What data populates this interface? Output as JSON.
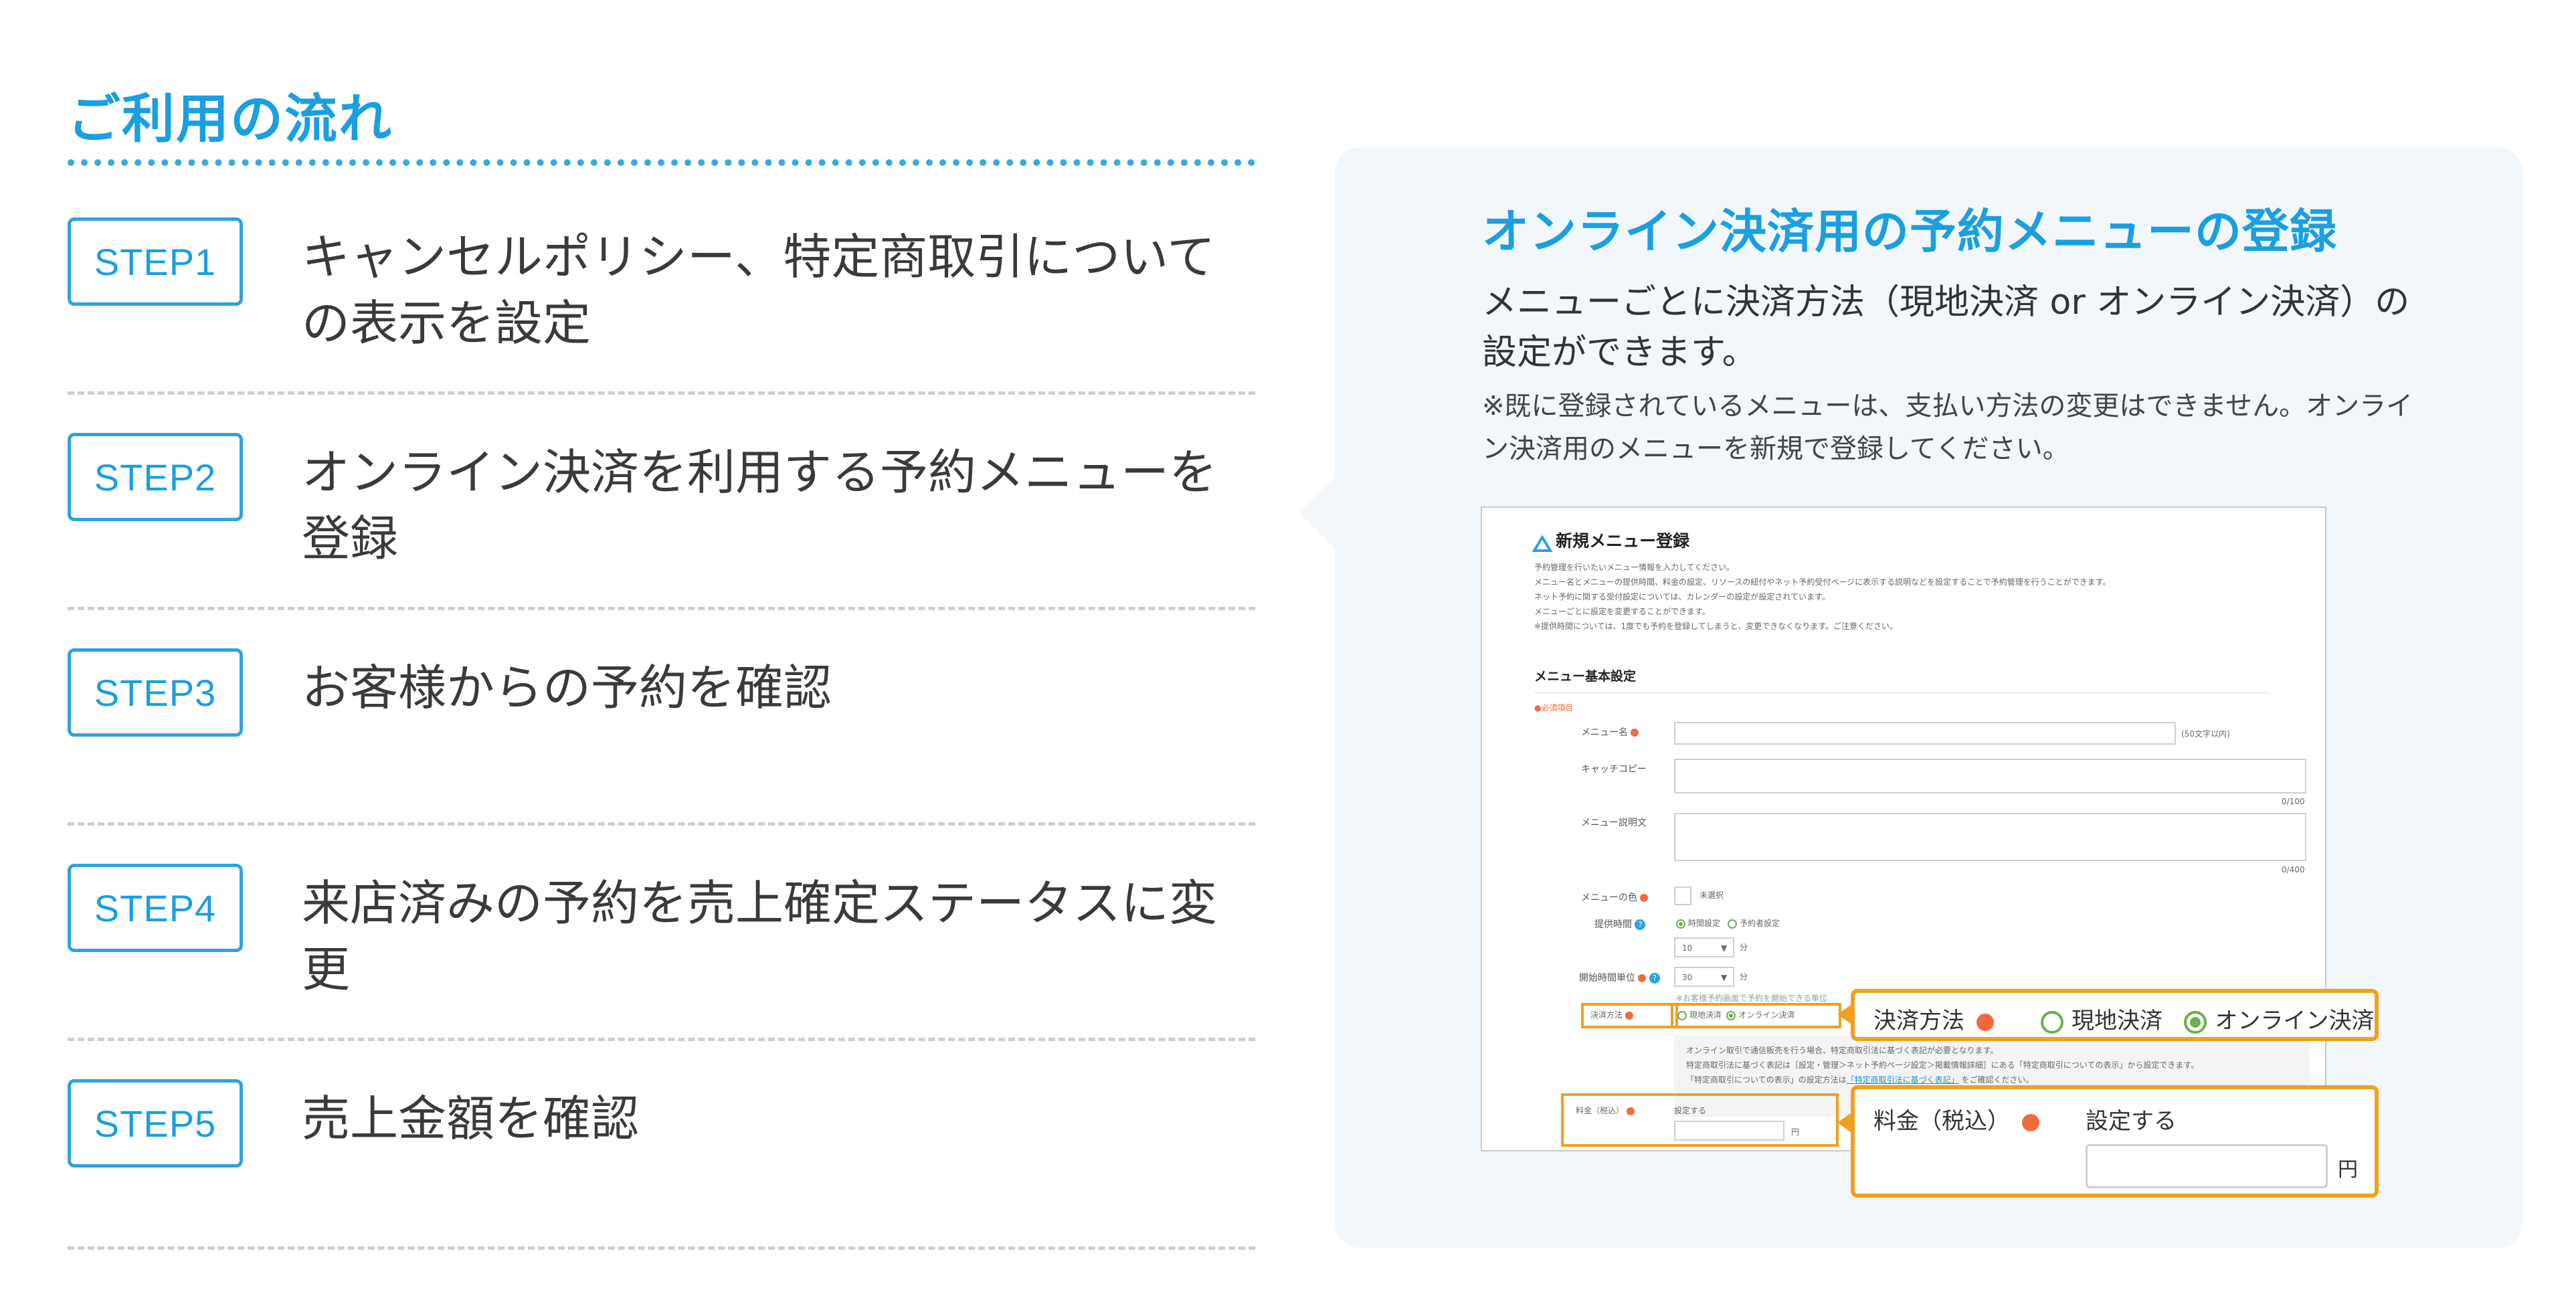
{
  "section_title": "ご利用の流れ",
  "steps": [
    {
      "badge": "STEP1",
      "text": "キャンセルポリシー、特定商取引についての表示を設定"
    },
    {
      "badge": "STEP2",
      "text": "オンライン決済を利用する予約メニューを登録"
    },
    {
      "badge": "STEP3",
      "text": "お客様からの予約を確認"
    },
    {
      "badge": "STEP4",
      "text": "来店済みの予約を売上確定ステータスに変更"
    },
    {
      "badge": "STEP5",
      "text": "売上金額を確認"
    }
  ],
  "panel": {
    "title": "オンライン決済用の予約メニューの登録",
    "desc": "メニューごとに決済方法（現地決済 or オンライン決済）の設定ができます。",
    "note": "※既に登録されているメニューは、支払い方法の変更はできません。オンライン決済用のメニューを新規で登録してください。"
  },
  "screenshot": {
    "title": "新規メニュー登録",
    "intro": [
      "予約管理を行いたいメニュー情報を入力してください。",
      "メニュー名とメニューの提供時間、料金の設定、リソースの紐付やネット予約受付ページに表示する説明などを設定することで予約管理を行うことができます。",
      "ネット予約に関する受付設定については、カレンダーの設定が設定されています。",
      "メニューごとに設定を変更することができます。",
      "※提供時間については、1度でも予約を登録してしまうと、変更できなくなります。ご注意ください。"
    ],
    "section": "メニュー基本設定",
    "required_note": "●必須項目",
    "fields": {
      "menu_name": "メニュー名",
      "menu_name_hint": "(50文字以内)",
      "catch_copy": "キャッチコピー",
      "catch_count": "0/100",
      "description": "メニュー説明文",
      "desc_count": "0/400",
      "color": "メニューの色",
      "color_value": "未選択",
      "duration": "提供時間",
      "duration_opt1": "時間設定",
      "duration_opt2": "予約者設定",
      "duration_value": "10",
      "duration_unit": "分",
      "start_unit": "開始時間単位",
      "start_value": "30",
      "start_unit_label": "分",
      "start_hint": "※お客様予約画面で予約を開始できる単位",
      "payment": "決済方法",
      "pay_opt1": "現地決済",
      "pay_opt2": "オンライン決済",
      "online_note": [
        "オンライン取引で通信販売を行う場合、特定商取引法に基づく表記が必要となります。",
        "特定商取引法に基づく表記は［設定・管理＞ネット予約ページ設定＞掲載情報詳細］にある「特定商取引についての表示」から設定できます。",
        "「特定商取引についての表示」の設定方法は"
      ],
      "online_link": "「特定商取引法に基づく表記」",
      "online_tail": "をご確認ください。",
      "price": "料金（税込）",
      "price_value": "設定する",
      "price_unit": "円"
    }
  },
  "callouts": {
    "payment": {
      "label": "決済方法",
      "opt1": "現地決済",
      "opt2": "オンライン決済",
      "selected": "オンライン決済"
    },
    "price": {
      "label": "料金（税込）",
      "value": "設定する",
      "unit": "円"
    }
  },
  "colors": {
    "accent": "#1a9fe0",
    "callout": "#f1a01e",
    "required": "#f26a3c",
    "radio": "#6ab04c",
    "panel_bg": "#f1f7fa"
  }
}
